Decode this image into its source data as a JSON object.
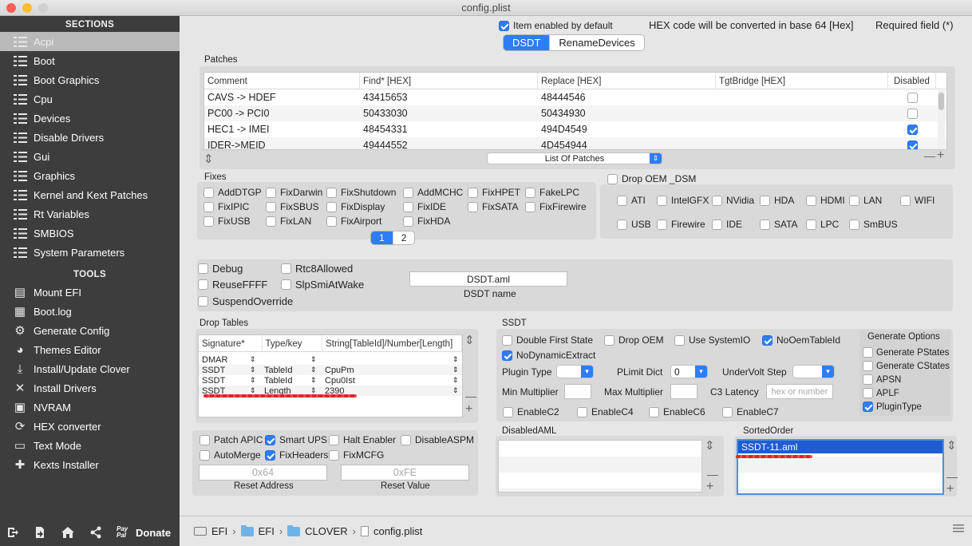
{
  "window": {
    "title": "config.plist"
  },
  "sidebar": {
    "sections_header": "SECTIONS",
    "sections": [
      {
        "label": "Acpi",
        "selected": true
      },
      {
        "label": "Boot"
      },
      {
        "label": "Boot Graphics"
      },
      {
        "label": "Cpu"
      },
      {
        "label": "Devices"
      },
      {
        "label": "Disable Drivers"
      },
      {
        "label": "Gui"
      },
      {
        "label": "Graphics"
      },
      {
        "label": "Kernel and Kext Patches"
      },
      {
        "label": "Rt Variables"
      },
      {
        "label": "SMBIOS"
      },
      {
        "label": "System Parameters"
      }
    ],
    "tools_header": "TOOLS",
    "tools": [
      {
        "label": "Mount EFI",
        "icon": "hard-drive-icon"
      },
      {
        "label": "Boot.log",
        "icon": "log-icon"
      },
      {
        "label": "Generate Config",
        "icon": "gears-icon"
      },
      {
        "label": "Themes Editor",
        "icon": "palette-icon"
      },
      {
        "label": "Install/Update Clover",
        "icon": "download-icon"
      },
      {
        "label": "Install Drivers",
        "icon": "wrench-icon"
      },
      {
        "label": "NVRAM",
        "icon": "chip-icon"
      },
      {
        "label": "HEX converter",
        "icon": "convert-icon"
      },
      {
        "label": "Text Mode",
        "icon": "text-icon"
      },
      {
        "label": "Kexts Installer",
        "icon": "lego-icon"
      }
    ],
    "donate_label": "Donate",
    "paypal_label": "Pay Pal"
  },
  "top": {
    "item_enabled_label": "Item enabled by default",
    "hex_info": "HEX code will be converted in base 64 [Hex]",
    "required_info": "Required field (*)",
    "tabs": [
      "DSDT",
      "RenameDevices"
    ]
  },
  "patches": {
    "title": "Patches",
    "headers": [
      "Comment",
      "Find* [HEX]",
      "Replace [HEX]",
      "TgtBridge [HEX]",
      "Disabled"
    ],
    "rows": [
      {
        "comment": "CAVS -> HDEF",
        "find": "43415653",
        "replace": "48444546",
        "tgt": "",
        "disabled": false
      },
      {
        "comment": "PC00 -> PCI0",
        "find": "50433030",
        "replace": "50434930",
        "tgt": "",
        "disabled": false
      },
      {
        "comment": "HEC1 -> IMEI",
        "find": "48454331",
        "replace": "494D4549",
        "tgt": "",
        "disabled": true
      },
      {
        "comment": "IDER->MEID",
        "find": "49444552",
        "replace": "4D454944",
        "tgt": "",
        "disabled": true
      }
    ],
    "list_label": "List Of Patches"
  },
  "fixes": {
    "title": "Fixes",
    "items": [
      {
        "label": "AddDTGP",
        "checked": false
      },
      {
        "label": "FixDarwin",
        "checked": false
      },
      {
        "label": "FixShutdown",
        "checked": false
      },
      {
        "label": "AddMCHC",
        "checked": false
      },
      {
        "label": "FixHPET",
        "checked": false
      },
      {
        "label": "FakeLPC",
        "checked": false
      },
      {
        "label": "FixIPIC",
        "checked": false
      },
      {
        "label": "FixSBUS",
        "checked": false
      },
      {
        "label": "FixDisplay",
        "checked": false
      },
      {
        "label": "FixIDE",
        "checked": false
      },
      {
        "label": "FixSATA",
        "checked": false
      },
      {
        "label": "FixFirewire",
        "checked": false
      },
      {
        "label": "FixUSB",
        "checked": false
      },
      {
        "label": "FixLAN",
        "checked": false
      },
      {
        "label": "FixAirport",
        "checked": false
      },
      {
        "label": "FixHDA",
        "checked": false
      }
    ],
    "pages": [
      "1",
      "2"
    ]
  },
  "drop_oem_dsm": {
    "title": "Drop OEM _DSM",
    "items": [
      {
        "label": "ATI"
      },
      {
        "label": "IntelGFX"
      },
      {
        "label": "NVidia"
      },
      {
        "label": "HDA"
      },
      {
        "label": "HDMI"
      },
      {
        "label": "LAN"
      },
      {
        "label": "WIFI"
      },
      {
        "label": "USB"
      },
      {
        "label": "Firewire"
      },
      {
        "label": "IDE"
      },
      {
        "label": "SATA"
      },
      {
        "label": "LPC"
      },
      {
        "label": "SmBUS"
      }
    ]
  },
  "misc": {
    "items": [
      {
        "label": "Debug"
      },
      {
        "label": "Rtc8Allowed"
      },
      {
        "label": "ReuseFFFF"
      },
      {
        "label": "SlpSmiAtWake"
      },
      {
        "label": "SuspendOverride"
      }
    ],
    "dsdt_name_value": "DSDT.aml",
    "dsdt_name_label": "DSDT name"
  },
  "drop_tables": {
    "title": "Drop Tables",
    "headers": [
      "Signature*",
      "Type/key",
      "String[TableId]/Number[Length]"
    ],
    "rows": [
      {
        "sig": "DMAR",
        "type": "",
        "value": ""
      },
      {
        "sig": "SSDT",
        "type": "TableId",
        "value": "CpuPm"
      },
      {
        "sig": "SSDT",
        "type": "TableId",
        "value": "Cpu0Ist"
      },
      {
        "sig": "SSDT",
        "type": "Length",
        "value": "2390"
      }
    ]
  },
  "ssdt": {
    "title": "SSDT",
    "checks": [
      {
        "label": "Double First State",
        "checked": false
      },
      {
        "label": "Drop OEM",
        "checked": false
      },
      {
        "label": "Use SystemIO",
        "checked": false
      },
      {
        "label": "NoOemTableId",
        "checked": true
      },
      {
        "label": "NoDynamicExtract",
        "checked": true
      }
    ],
    "plugin_type_label": "Plugin Type",
    "plimit_label": "PLimit Dict",
    "plimit_value": "0",
    "undervolt_label": "UnderVolt Step",
    "min_mult_label": "Min Multiplier",
    "max_mult_label": "Max Multiplier",
    "c3_label": "C3 Latency",
    "c3_placeholder": "hex or number",
    "enable_checks": [
      {
        "label": "EnableC2"
      },
      {
        "label": "EnableC4"
      },
      {
        "label": "EnableC6"
      },
      {
        "label": "EnableC7"
      }
    ],
    "gen_title": "Generate Options",
    "gen_items": [
      {
        "label": "Generate PStates",
        "checked": false
      },
      {
        "label": "Generate CStates",
        "checked": false
      },
      {
        "label": "APSN",
        "checked": false
      },
      {
        "label": "APLF",
        "checked": false
      },
      {
        "label": "PluginType",
        "checked": true
      }
    ]
  },
  "bottom_checks": {
    "items": [
      {
        "label": "Patch APIC",
        "checked": false
      },
      {
        "label": "Smart UPS",
        "checked": true
      },
      {
        "label": "Halt Enabler",
        "checked": false
      },
      {
        "label": "DisableASPM",
        "checked": false
      },
      {
        "label": "AutoMerge",
        "checked": false
      },
      {
        "label": "FixHeaders",
        "checked": true
      },
      {
        "label": "FixMCFG",
        "checked": false
      }
    ],
    "reset_address_placeholder": "0x64",
    "reset_address_label": "Reset Address",
    "reset_value_placeholder": "0xFE",
    "reset_value_label": "Reset Value"
  },
  "disabled_aml": {
    "title": "DisabledAML"
  },
  "sorted_order": {
    "title": "SortedOrder",
    "items": [
      "SSDT-11.aml"
    ]
  },
  "pathbar": {
    "segments": [
      "EFI",
      "EFI",
      "CLOVER",
      "config.plist"
    ]
  },
  "colors": {
    "accent": "#2e7cf6",
    "sidebar": "#3d3d3d",
    "annotation_red": "#e0222b"
  }
}
